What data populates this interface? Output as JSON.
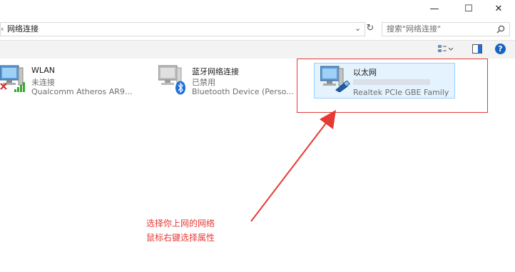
{
  "window": {
    "minimize_glyph": "—",
    "maximize_glyph": "☐",
    "close_glyph": "✕"
  },
  "address": {
    "back_glyph": "‹",
    "path": "网络连接",
    "dropdown_glyph": "⌄",
    "refresh_glyph": "↻"
  },
  "search": {
    "placeholder": "搜索\"网络连接\""
  },
  "toolbar": {
    "help_glyph": "?"
  },
  "connections": [
    {
      "name": "WLAN",
      "status": "未连接",
      "device": "Qualcomm Atheros AR9..."
    },
    {
      "name": "蓝牙网络连接",
      "status": "已禁用",
      "device": "Bluetooth Device (Perso..."
    },
    {
      "name": "以太网",
      "status": "",
      "device": "Realtek PCIe GBE Family ..."
    }
  ],
  "annotation": {
    "line1": "选择你上网的网络",
    "line2": "鼠标右键选择属性"
  },
  "colors": {
    "annotation_red": "#e53935",
    "selection_fill": "#e5f3ff",
    "selection_border": "#99d1ff",
    "help_blue": "#1565c0",
    "wifi_green": "#3aa935"
  }
}
